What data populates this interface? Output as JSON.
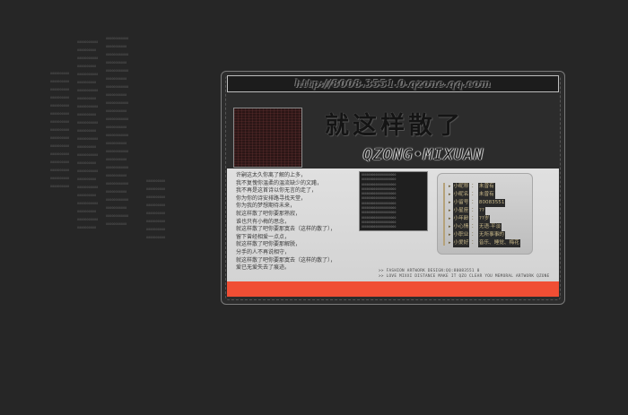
{
  "background_columns": {
    "col1": [
      "00000000000",
      "0000000000",
      "00000000000",
      "0000000000",
      "00000000000",
      "0000000000",
      "00000000000",
      "0000000000",
      "00000000000",
      "0000000000",
      "00000000000",
      "0000000000",
      "00000000000",
      "0000000000",
      "00000000000",
      "0000000000",
      "00000000000",
      "0000000000",
      "00000000000",
      "0000000000",
      "00000000000",
      "0000000000",
      "00000000000",
      "0000000000"
    ],
    "col2": [
      "000000000000",
      "00000000000",
      "000000000000",
      "00000000000",
      "000000000000",
      "00000000000",
      "000000000000",
      "00000000000",
      "000000000000",
      "00000000000",
      "000000000000",
      "00000000000",
      "000000000000",
      "00000000000",
      "000000000000",
      "00000000000",
      "000000000000",
      "00000000000",
      "000000000000",
      "00000000000",
      "000000000000",
      "00000000000",
      "000000000000",
      "00000000000"
    ],
    "col3": [
      "0000000000",
      "0000000000",
      "0000000000",
      "0000000000",
      "0000000000",
      "0000000000",
      "0000000000",
      "0000000000",
      "0000000000",
      "0000000000",
      "0000000000",
      "0000000000",
      "0000000000",
      "0000000000",
      "0000000000"
    ],
    "col4": [
      "0000000000",
      "0000000000",
      "0000000000",
      "0000000000",
      "0000000000",
      "0000000000",
      "0000000000",
      "0000000000"
    ]
  },
  "header": {
    "url": "http://8008.3551.0.qzone.qq.com"
  },
  "title": {
    "chinese": "就这样散了",
    "english": "QZONG•MIXUAN"
  },
  "poem": [
    "许嗣这太久你离了解的上多，",
    "我不复愧你温柔的温流缺少的文躇，",
    "我不再是这首诗以你无言的走了，",
    "你为你的诗安排路寻找天堂，",
    "你为我的梦想期待未来，",
    "就这样散了吧你要那熟寂，",
    "谁也只有小梅的思念，",
    "就这样散了吧你要那寞去（这样的散了），",
    "留下曾经相爱一点点，",
    "就这样散了吧你要那解脱，",
    "分手的人不再说相守，",
    "就这样散了吧你要那寞去（这样的散了），",
    "爱已无爱失去了痕迹。"
  ],
  "photo_text": [
    "00000000000000000000",
    "00000000000000000000",
    "00000000000000000000",
    "00000000000000000000",
    "00000000000000000000",
    "00000000000000000000",
    "00000000000000000000",
    "00000000000000000000",
    "00000000000000000000",
    "00000000000000000000",
    "00000000000000000000",
    "00000000000000000000",
    "00000000000000000000",
    "00000000000000000000"
  ],
  "profile": {
    "items": [
      {
        "k": "小昵称",
        "v": "未曾有"
      },
      {
        "k": "小昵名",
        "v": "未曾有"
      },
      {
        "k": "小留号",
        "v": "80083551"
      },
      {
        "k": "小星座",
        "v": "??"
      },
      {
        "k": "小年龄",
        "v": "??岁"
      },
      {
        "k": "小心情",
        "v": "无语·平淡"
      },
      {
        "k": "小职业",
        "v": "无所事事的"
      },
      {
        "k": "小爱好",
        "v": "音乐、睡觉、梅花"
      }
    ]
  },
  "credits": {
    "line1": ">> FASHION ARTWORK DESIGN:QQ:80083551 0",
    "line2": ">> LOVE MIXXI DISTANCE MAKE IT QZO CLEAR YOU MEMORAL ARTWORK QZONE"
  },
  "colors": {
    "footer_bar": "#f04e34",
    "page_bg": "#262626",
    "accent_gold": "#c9b98a"
  }
}
